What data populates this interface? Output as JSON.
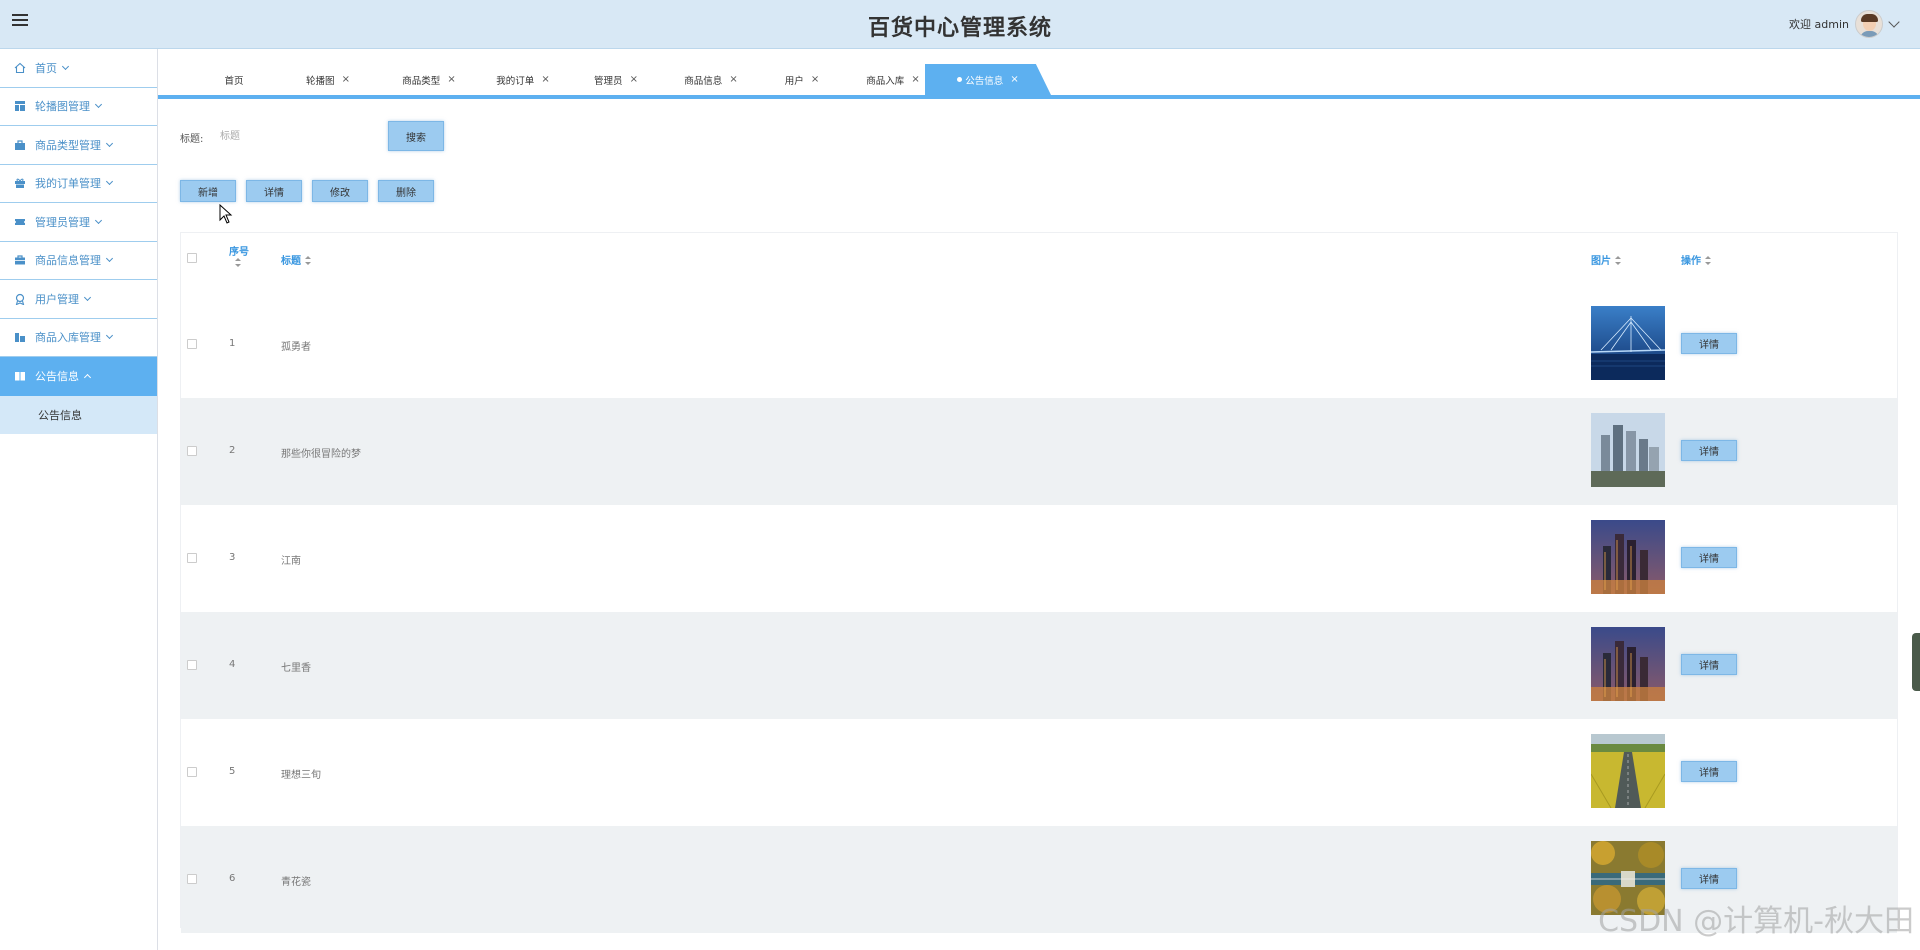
{
  "header": {
    "title": "百货中心管理系统",
    "welcome": "欢迎 admin"
  },
  "sidebar": {
    "items": [
      {
        "label": "首页",
        "icon": "home-icon"
      },
      {
        "label": "轮播图管理",
        "icon": "layout-icon"
      },
      {
        "label": "商品类型管理",
        "icon": "bag-icon"
      },
      {
        "label": "我的订单管理",
        "icon": "gift-icon"
      },
      {
        "label": "管理员管理",
        "icon": "ticket-icon"
      },
      {
        "label": "商品信息管理",
        "icon": "briefcase-icon"
      },
      {
        "label": "用户管理",
        "icon": "award-icon"
      },
      {
        "label": "商品入库管理",
        "icon": "building-icon"
      },
      {
        "label": "公告信息",
        "icon": "book-icon"
      }
    ],
    "submenu": {
      "label": "公告信息"
    }
  },
  "tabs": [
    {
      "label": "首页",
      "closable": false
    },
    {
      "label": "轮播图",
      "closable": true
    },
    {
      "label": "商品类型",
      "closable": true
    },
    {
      "label": "我的订单",
      "closable": true
    },
    {
      "label": "管理员",
      "closable": true
    },
    {
      "label": "商品信息",
      "closable": true
    },
    {
      "label": "用户",
      "closable": true
    },
    {
      "label": "商品入库",
      "closable": true
    },
    {
      "label": "公告信息",
      "closable": true,
      "active": true
    }
  ],
  "tab_close": "×",
  "search": {
    "label": "标题:",
    "placeholder": "标题",
    "button": "搜索"
  },
  "actions": {
    "add": "新增",
    "detail": "详情",
    "edit": "修改",
    "delete": "删除"
  },
  "table": {
    "headers": {
      "index": "序号",
      "title": "标题",
      "image": "图片",
      "operation": "操作"
    },
    "rows": [
      {
        "index": "1",
        "title": "孤勇者",
        "image": "bridge-night"
      },
      {
        "index": "2",
        "title": "那些你很冒险的梦",
        "image": "city-skyline-day"
      },
      {
        "index": "3",
        "title": "江南",
        "image": "city-skyline-dusk"
      },
      {
        "index": "4",
        "title": "七里香",
        "image": "city-skyline-dusk"
      },
      {
        "index": "5",
        "title": "理想三旬",
        "image": "field-road"
      },
      {
        "index": "6",
        "title": "青花瓷",
        "image": "bridge-autumn"
      }
    ],
    "row_button": "详情"
  },
  "watermark": "CSDN @计算机-秋大田",
  "colors": {
    "accent": "#5db0f0",
    "header_bg": "#d8e8f5",
    "button": "#9ccbf0",
    "table_header_text": "#3a97e0"
  }
}
